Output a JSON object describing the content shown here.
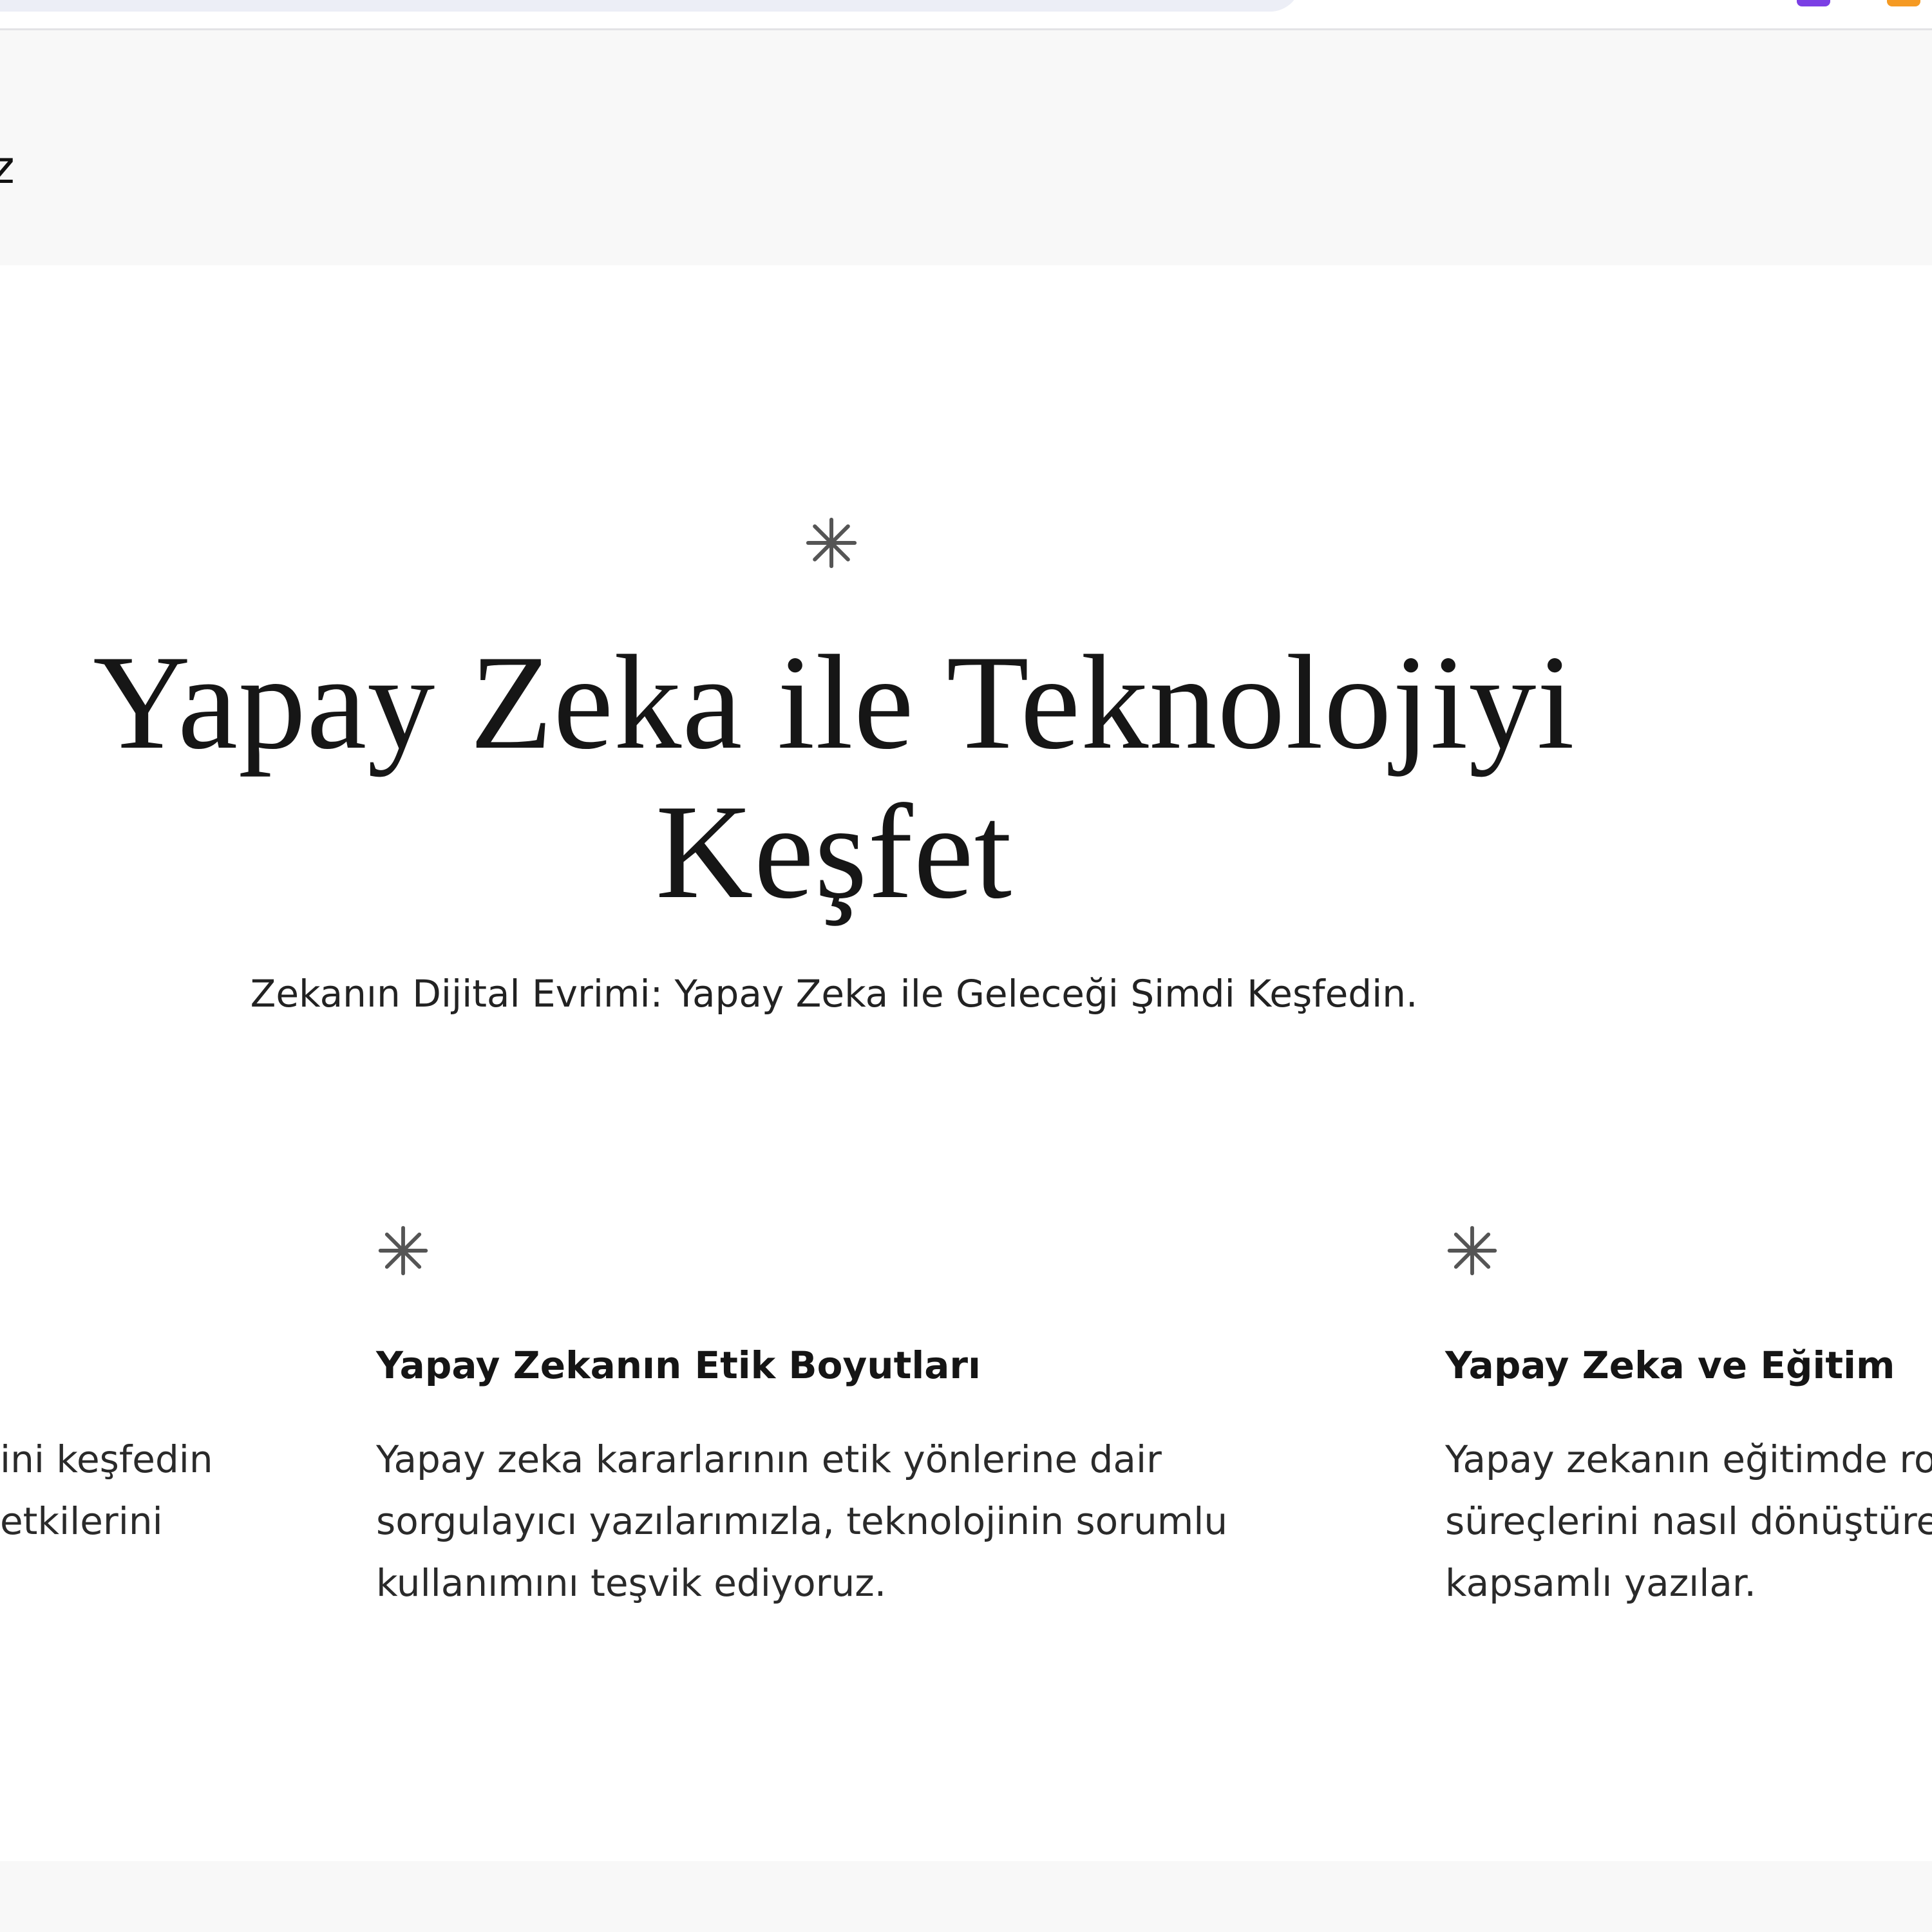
{
  "browser": {
    "extension_icons": [
      "purple-extension-icon",
      "orange-extension-icon"
    ]
  },
  "header": {
    "logo_fragment": "z"
  },
  "hero": {
    "icon": "asterisk-icon",
    "title_line_1": "Yapay Zeka ile Teknolojiyi",
    "title_line_2": "Keşfet",
    "subtitle": "Zekanın Dijital Evrimi: Yapay Zeka ile Geleceği Şimdi Keşfedin."
  },
  "features": [
    {
      "icon": "asterisk-icon",
      "title": "",
      "description_lines": [
        "ini keşfedin",
        "etkilerini"
      ]
    },
    {
      "icon": "asterisk-icon",
      "title": "Yapay Zekanın Etik Boyutları",
      "description_lines": [
        "Yapay zeka kararlarının etik yönlerine dair",
        "sorgulayıcı yazılarımızla, teknolojinin sorumlu",
        "kullanımını teşvik ediyoruz."
      ]
    },
    {
      "icon": "asterisk-icon",
      "title": "Yapay Zeka ve Eğitim",
      "description_lines": [
        "Yapay zekanın eğitimde ro",
        "süreçlerini nasıl dönüştüre",
        "kapsamlı yazılar."
      ]
    }
  ],
  "colors": {
    "page_background": "#ffffff",
    "header_background": "#f8f8f8",
    "asterisk": "#555555",
    "text": "#111111"
  }
}
